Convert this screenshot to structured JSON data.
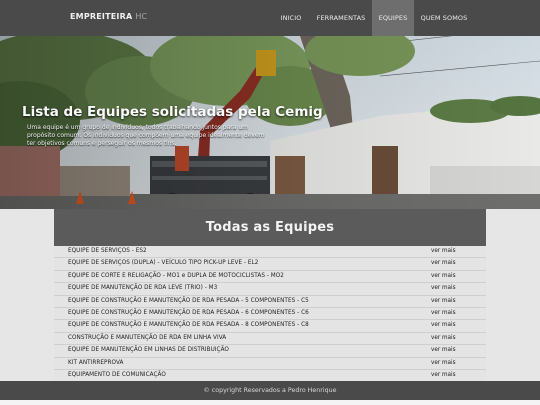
{
  "navbar": {
    "brand_main": "EMPREITEIRA",
    "brand_sub": "HC",
    "items": [
      {
        "label": "INICIO",
        "active": false
      },
      {
        "label": "FERRAMENTAS",
        "active": false
      },
      {
        "label": "EQUIPES",
        "active": true
      },
      {
        "label": "QUEM SOMOS",
        "active": false
      }
    ]
  },
  "hero": {
    "title": "Lista de Equipes solicitadas pela Cemig",
    "text": "Uma equipe é um grupo de indivíduos, todos trabalhando juntos para um propósito comum. Os indivíduos que compõem uma equipe idealmente devem ter objetivos comuns e perseguir os mesmos fins."
  },
  "teams": {
    "header": "Todas as Equipes",
    "link_label": "ver mais",
    "rows": [
      "EQUIPE DE SERVIÇOS - ES2",
      "EQUIPE DE SERVIÇOS (DUPLA) - VEÍCULO TIPO PICK-UP LEVE - EL2",
      "EQUIPE DE CORTE E RELIGAÇÃO - MO1 e DUPLA DE MOTOCICLISTAS - MO2",
      "EQUIPE DE MANUTENÇÃO DE RDA LEVE (TRIO) - M3",
      "EQUIPE DE CONSTRUÇÃO E MANUTENÇÃO DE RDA PESADA - 5 COMPONENTES - C5",
      "EQUIPE DE CONSTRUÇÃO E MANUTENÇÃO DE RDA PESADA - 6 COMPONENTES - C6",
      "EQUIPE DE CONSTRUÇÃO E MANUTENÇÃO DE RDA PESADA - 8 COMPONENTES - C8",
      "CONSTRUÇÃO E MANUTENÇÃO DE RDA EM LINHA VIVA",
      "EQUIPE DE MANUTENÇÃO EM LINHAS DE DISTRIBUIÇÃO",
      "KIT ANTIRREPROVA",
      "EQUIPAMENTO DE COMUNICAÇÃO"
    ]
  },
  "footer": {
    "text": "© copyright Reservados a Pedro Henrique"
  }
}
